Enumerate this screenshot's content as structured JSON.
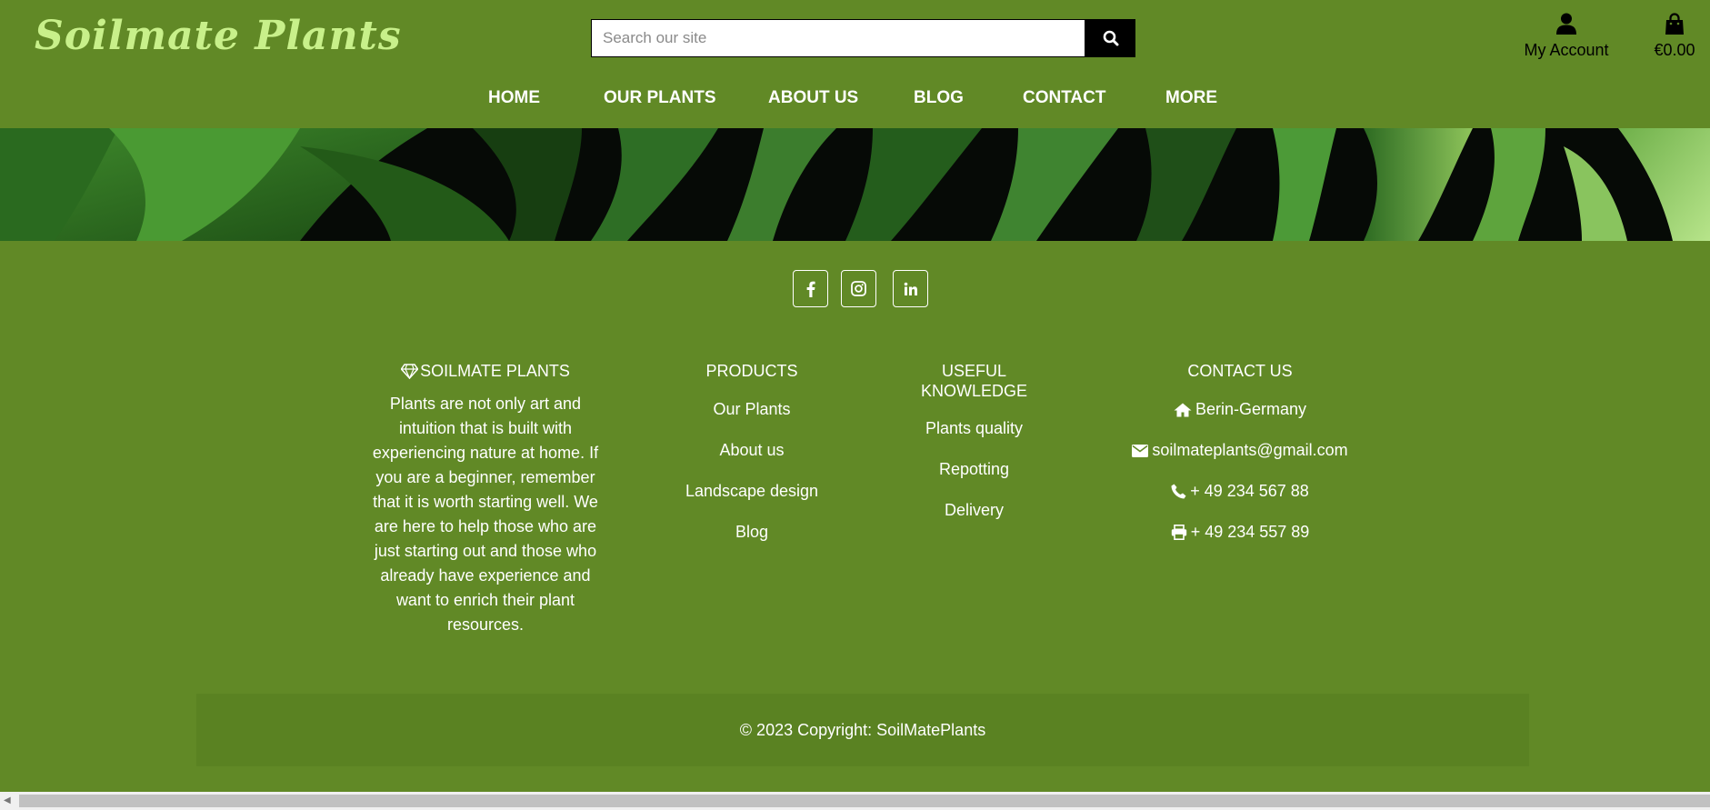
{
  "header": {
    "brand": "Soilmate Plants",
    "search_placeholder": "Search our site",
    "account_label": "My Account",
    "cart_total": "€0.00"
  },
  "nav": {
    "items": [
      "HOME",
      "OUR PLANTS",
      "ABOUT US",
      "BLOG",
      "CONTACT",
      "MORE"
    ]
  },
  "social": {
    "icons": [
      "facebook-icon",
      "instagram-icon",
      "linkedin-icon"
    ]
  },
  "footer": {
    "about": {
      "heading": "SOILMATE PLANTS",
      "text": "Plants are not only art and intuition that is built with experiencing nature at home. If you are a beginner, remember that it is worth starting well. We are here to help those who are just starting out and those who already have experience and want to enrich their plant resources."
    },
    "products": {
      "heading": "PRODUCTS",
      "items": [
        "Our Plants",
        "About us",
        "Landscape design",
        "Blog"
      ]
    },
    "knowledge": {
      "heading": "USEFUL KNOWLEDGE",
      "items": [
        "Plants quality",
        "Repotting",
        "Delivery"
      ]
    },
    "contact": {
      "heading": "CONTACT US",
      "address": "Berin-Germany",
      "email": "soilmateplants@gmail.com",
      "phone": "+ 49 234 567 88",
      "fax": "+ 49 234 557 89"
    },
    "copyright": "© 2023 Copyright: SoilMatePlants"
  },
  "colors": {
    "background": "#618926",
    "brand": "#c8f08a",
    "copyright_bar": "#5a8222"
  }
}
